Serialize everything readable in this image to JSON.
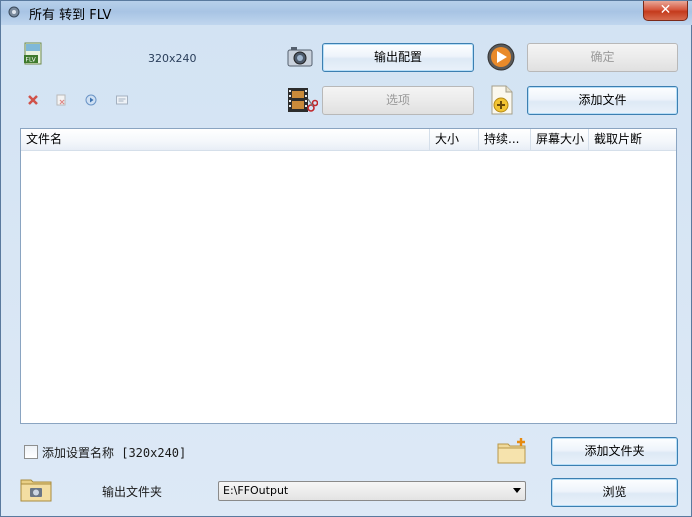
{
  "window": {
    "title": "所有 转到 FLV",
    "close_label": "✕"
  },
  "toolbar": {
    "resolution": "320x240",
    "output_config_label": "输出配置",
    "ok_label": "确定",
    "options_label": "选项",
    "add_file_label": "添加文件"
  },
  "file_list": {
    "columns": [
      "文件名",
      "大小",
      "持续...",
      "屏幕大小",
      "截取片断"
    ],
    "rows": []
  },
  "bottom": {
    "add_setting_name_label": "添加设置名称 [320x240]",
    "add_setting_name_checked": false,
    "add_folder_label": "添加文件夹",
    "output_folder_label": "输出文件夹",
    "output_folder_value": "E:\\FFOutput",
    "browse_label": "浏览"
  },
  "icons": {
    "title": "gear-icon",
    "flv_file": "flv-file-icon",
    "remove": "remove-icon",
    "clear": "clear-icon",
    "play": "play-icon",
    "info": "info-icon",
    "output_config": "camera-settings-icon",
    "ok": "orange-arrow-icon",
    "options": "film-clip-icon",
    "add_file": "add-file-icon",
    "add_folder": "add-folder-icon",
    "output_folder": "output-folder-icon"
  }
}
